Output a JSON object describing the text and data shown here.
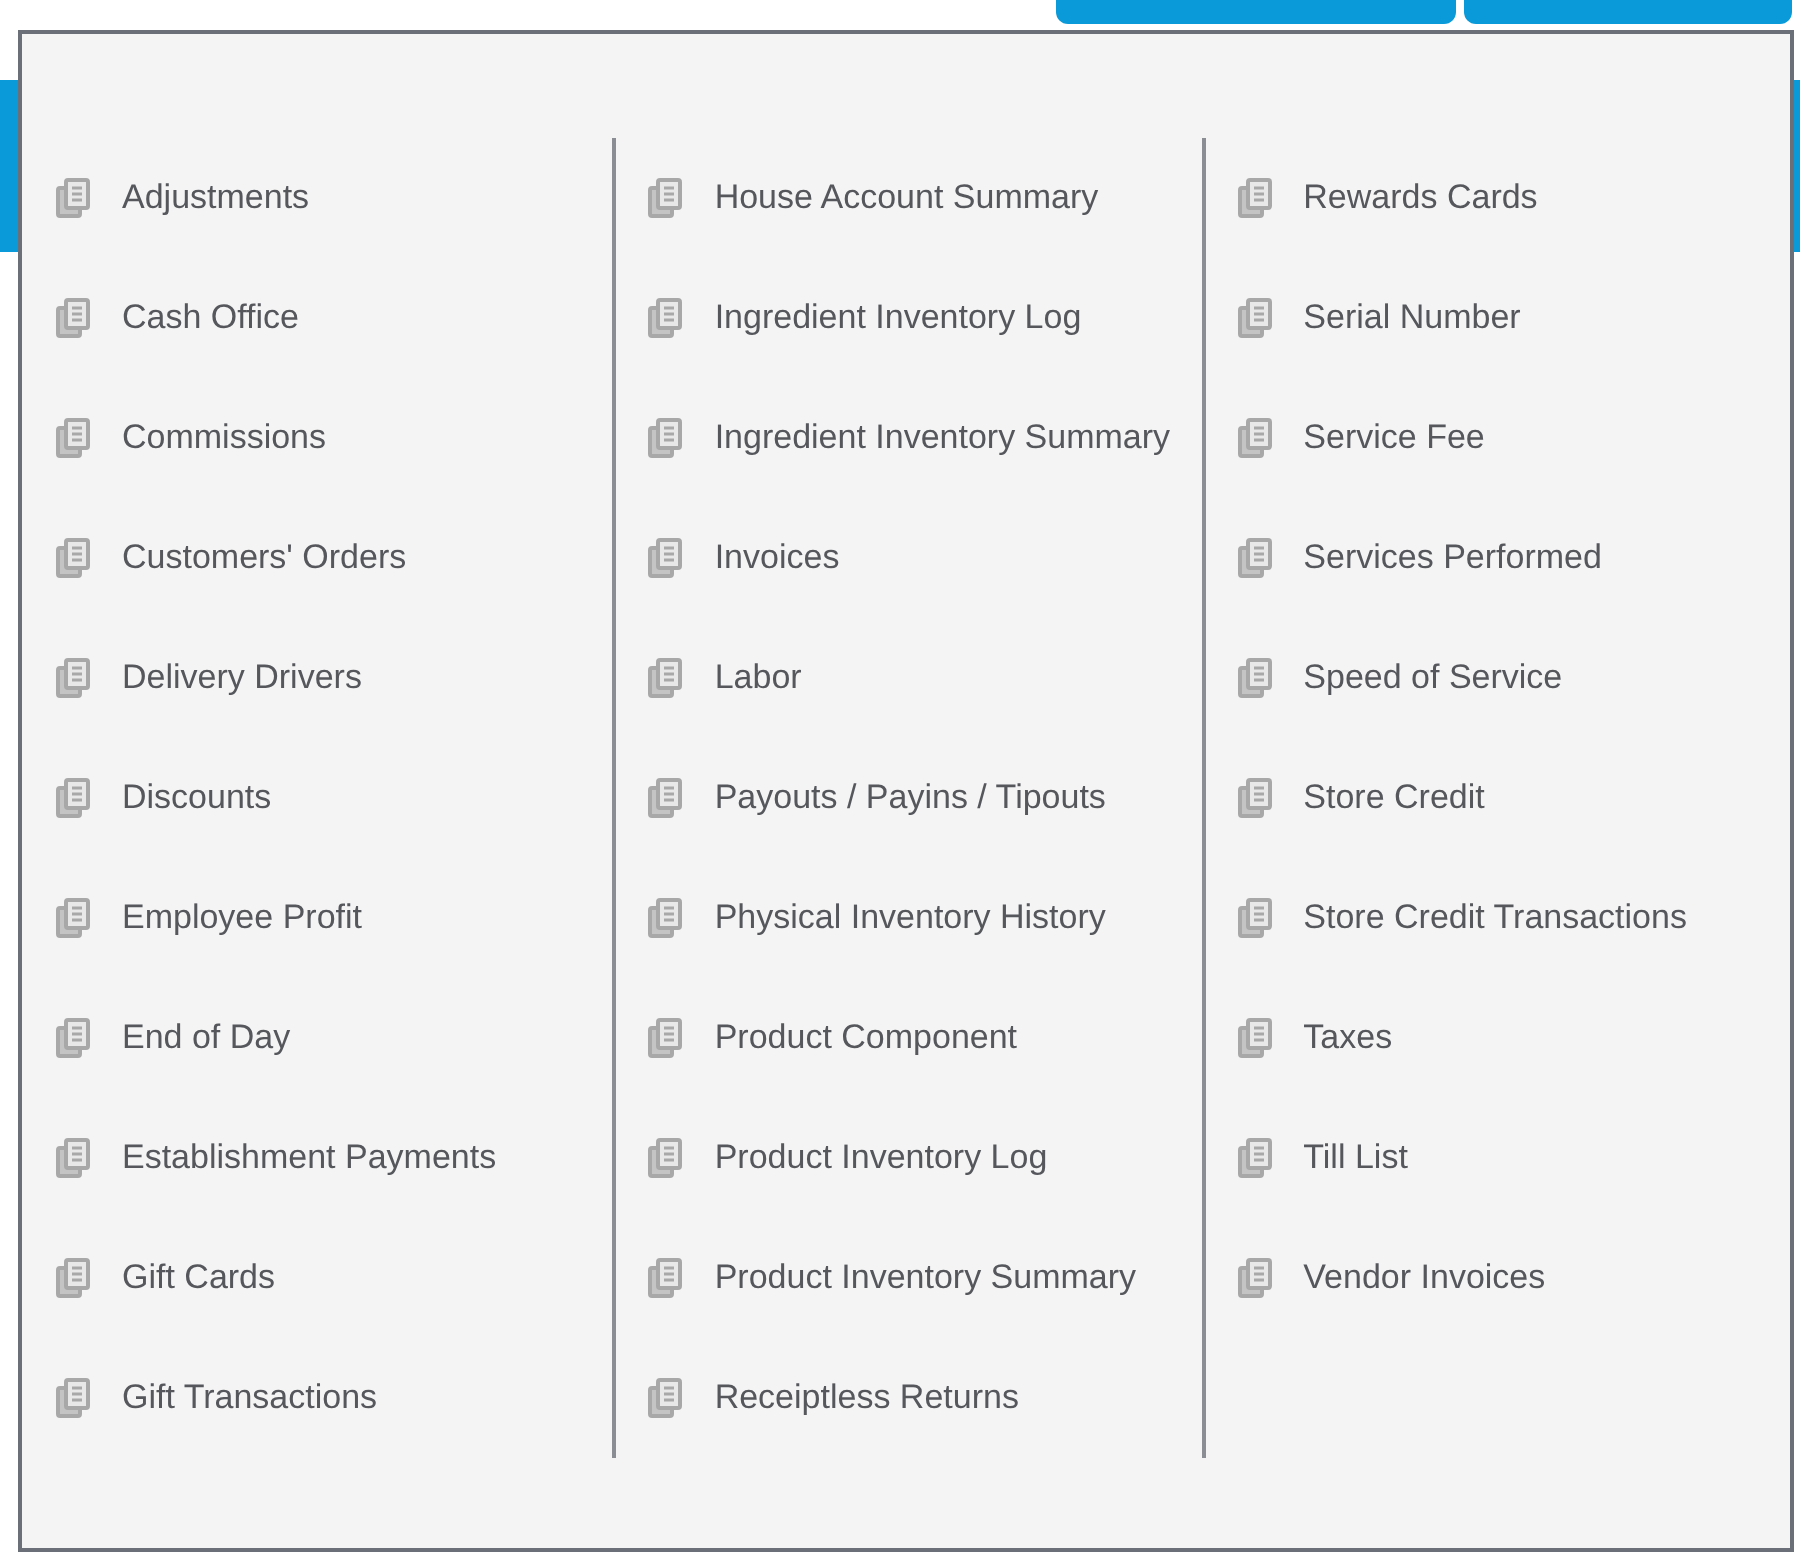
{
  "report_menu": {
    "columns": [
      {
        "items": [
          {
            "label": "Adjustments"
          },
          {
            "label": "Cash Office"
          },
          {
            "label": "Commissions"
          },
          {
            "label": "Customers' Orders"
          },
          {
            "label": "Delivery Drivers"
          },
          {
            "label": "Discounts"
          },
          {
            "label": "Employee Profit"
          },
          {
            "label": "End of Day"
          },
          {
            "label": "Establishment Payments"
          },
          {
            "label": "Gift Cards"
          },
          {
            "label": "Gift Transactions"
          }
        ]
      },
      {
        "items": [
          {
            "label": "House Account Summary"
          },
          {
            "label": "Ingredient Inventory Log"
          },
          {
            "label": "Ingredient Inventory Summary"
          },
          {
            "label": "Invoices"
          },
          {
            "label": "Labor"
          },
          {
            "label": "Payouts / Payins / Tipouts"
          },
          {
            "label": "Physical Inventory History"
          },
          {
            "label": "Product Component"
          },
          {
            "label": "Product Inventory Log"
          },
          {
            "label": "Product Inventory Summary"
          },
          {
            "label": "Receiptless Returns"
          }
        ]
      },
      {
        "items": [
          {
            "label": "Rewards Cards"
          },
          {
            "label": "Serial Number"
          },
          {
            "label": "Service Fee"
          },
          {
            "label": "Services Performed"
          },
          {
            "label": "Speed of Service"
          },
          {
            "label": "Store Credit"
          },
          {
            "label": "Store Credit Transactions"
          },
          {
            "label": "Taxes"
          },
          {
            "label": "Till List"
          },
          {
            "label": "Vendor Invoices"
          }
        ]
      }
    ]
  }
}
